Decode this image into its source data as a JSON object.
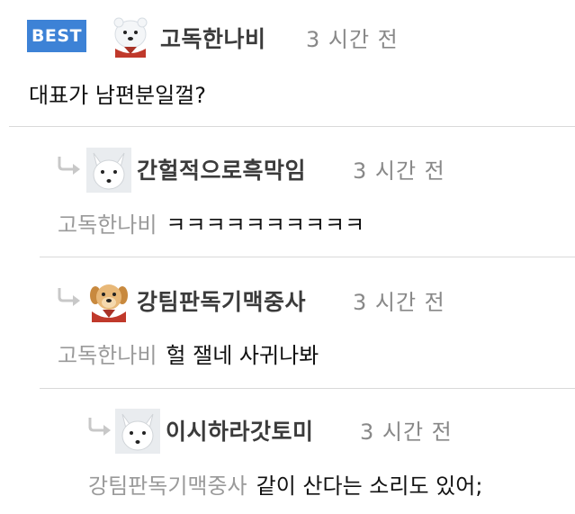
{
  "best_comment": {
    "badge": "BEST",
    "author": "고독한나비",
    "time": "3 시간 전",
    "text": "대표가 남편분일껄?",
    "avatar_icon": "polar-bear-avatar"
  },
  "replies": [
    {
      "author": "간헐적으로흑막임",
      "time": "3 시간 전",
      "mention": "고독한나비",
      "text": "ㅋㅋㅋㅋㅋㅋㅋㅋㅋㅋ",
      "avatar_icon": "arctic-fox-avatar"
    },
    {
      "author": "강팀판독기맥중사",
      "time": "3 시간 전",
      "mention": "고독한나비",
      "text": "헐 잴네 사귀나봐",
      "avatar_icon": "puppy-avatar"
    },
    {
      "author": "이시하라갓토미",
      "time": "3 시간 전",
      "mention": "강팀판독기맥중사",
      "text": "같이 산다는 소리도 있어;",
      "avatar_icon": "arctic-fox-avatar"
    }
  ],
  "colors": {
    "badge": "#3d82d6",
    "author": "#3b3b3b",
    "time": "#888888",
    "mention": "#9a9a9a",
    "divider": "#d9d9d9"
  }
}
